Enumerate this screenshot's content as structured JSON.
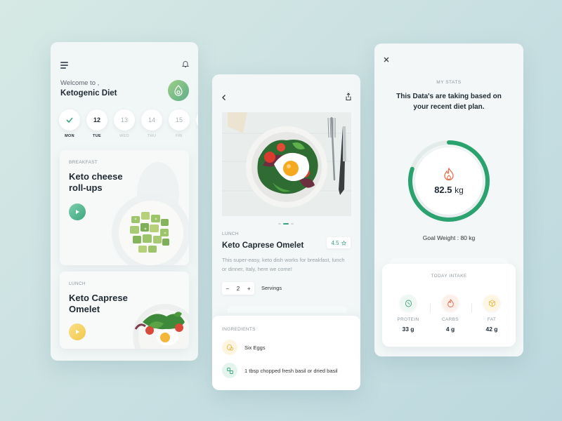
{
  "colors": {
    "accent": "#3aa57d",
    "ring": "#2aa36f",
    "fire": "#e86d4e",
    "yellow": "#f2c84b"
  },
  "home": {
    "welcome": "Welcome to ,",
    "title": "Ketogenic Diet",
    "days": [
      {
        "num": "",
        "label": "MON",
        "state": "checked"
      },
      {
        "num": "12",
        "label": "TUE",
        "state": "active"
      },
      {
        "num": "13",
        "label": "WED",
        "state": ""
      },
      {
        "num": "14",
        "label": "THU",
        "state": ""
      },
      {
        "num": "15",
        "label": "FRI",
        "state": ""
      }
    ],
    "meals": [
      {
        "tag": "BREAKFAST",
        "name_line1": "Keto cheese",
        "name_line2": "roll-ups"
      },
      {
        "tag": "LUNCH",
        "name_line1": "Keto Caprese",
        "name_line2": "Omelet"
      }
    ]
  },
  "recipe": {
    "tag": "LUNCH",
    "title": "Keto Caprese Omelet",
    "rating": "4.5",
    "description": "This super-easy, keto dish works for breakfast, lunch or dinner, Italy, here we come!",
    "servings_count": "2",
    "servings_label": "Servings",
    "minus": "−",
    "plus": "+",
    "ingredients_label": "INGREDIENTS",
    "ingredients": [
      "Six Eggs",
      "1 tbsp chopped fresh basil or dried basil"
    ]
  },
  "stats": {
    "section": "MY STATS",
    "headline_line1": "This Data's are taking based on",
    "headline_line2": "your recent diet plan.",
    "weight_value": "82.5",
    "weight_unit": "kg",
    "goal": "Goal Weight : 80 kg",
    "progress": 0.8,
    "intake_label": "TODAY INTAKE",
    "macros": [
      {
        "label": "PROTEIN",
        "value": "33 g"
      },
      {
        "label": "CARBS",
        "value": "4 g"
      },
      {
        "label": "FAT",
        "value": "42 g"
      }
    ]
  }
}
